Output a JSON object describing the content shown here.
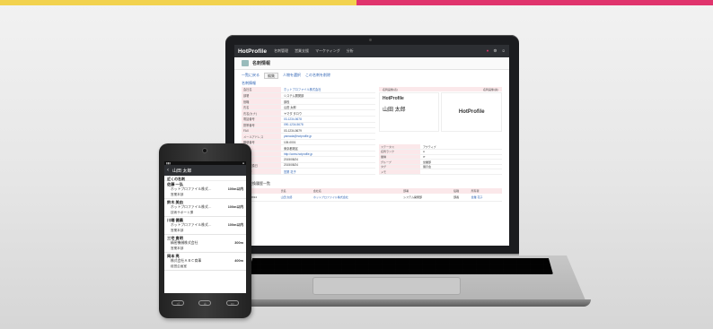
{
  "colors": {
    "strip_left": "#f2d24e",
    "strip_right": "#e0346d",
    "accent": "#e0346d",
    "link": "#3064b4"
  },
  "laptop_app": {
    "logo": "HotProfile",
    "nav": [
      "名刺管理",
      "営業支援",
      "マーケティング",
      "分析"
    ],
    "page_title": "名刺情報",
    "toolbar": {
      "back": "一覧に戻る",
      "edit": "編集",
      "link1": "人物を選択",
      "link2": "この名刺を削除"
    },
    "section_label": "名刺情報",
    "details": [
      {
        "k": "会社名",
        "v": "ホットプロファイル株式会社",
        "link": true
      },
      {
        "k": "部署",
        "v": "システム開発部",
        "link": false
      },
      {
        "k": "役職",
        "v": "部長",
        "link": false
      },
      {
        "k": "氏名",
        "v": "山田 太郎",
        "link": false
      },
      {
        "k": "氏名(カナ)",
        "v": "ヤマダ タロウ",
        "link": false
      },
      {
        "k": "電話番号",
        "v": "03-1234-5678",
        "link": true
      },
      {
        "k": "携帯番号",
        "v": "090-1234-5678",
        "link": true
      },
      {
        "k": "FAX",
        "v": "03-1234-5679",
        "link": false
      },
      {
        "k": "メールアドレス",
        "v": "yamada@hotprofile.jp",
        "link": true
      },
      {
        "k": "郵便番号",
        "v": "105-0001",
        "link": false
      },
      {
        "k": "住所",
        "v": "東京都港区",
        "link": false
      },
      {
        "k": "URL",
        "v": "http://www.hotprofile.jp",
        "link": true
      },
      {
        "k": "受付日",
        "v": "2015/08/24",
        "link": false
      },
      {
        "k": "名刺交換日",
        "v": "2015/08/24",
        "link": false
      },
      {
        "k": "所有者",
        "v": "営業 花子",
        "link": true
      }
    ],
    "card_head": {
      "front": "名刺画像(表)",
      "back": "名刺画像(裏)"
    },
    "card_front": {
      "logo": "HotProfile",
      "name": "山田 太郎"
    },
    "card_back": {
      "logo": "HotProfile"
    },
    "right_table": [
      {
        "k": "ステータス",
        "v": "アクティブ"
      },
      {
        "k": "名刺ランク",
        "v": "A"
      },
      {
        "k": "業種",
        "v": "IT"
      },
      {
        "k": "グループ",
        "v": "営業部"
      },
      {
        "k": "タグ",
        "v": "展示会"
      },
      {
        "k": "メモ",
        "v": ""
      }
    ],
    "list_title": "名刺交換履歴一覧",
    "list_headers": [
      "交換日",
      "氏名",
      "会社名",
      "部署",
      "役職",
      "所有者"
    ],
    "list_rows": [
      [
        "2015/08/24",
        "山田 太郎",
        "ホットプロファイル株式会社",
        "システム開発部",
        "部長",
        "営業 花子"
      ]
    ]
  },
  "phone_app": {
    "header_title": "山田 太郎",
    "section": "近くの名刺",
    "items": [
      {
        "name": "佐藤 一弘",
        "company": "ホットプロファイル株式…",
        "dist": "100m以内",
        "dept": "営業本部"
      },
      {
        "name": "鈴木 美由",
        "company": "ホットプロファイル株式…",
        "dist": "100m以内",
        "dept": "技術サポート課"
      },
      {
        "name": "川端 健義",
        "company": "ホットプロファイル株式…",
        "dist": "100m以内",
        "dept": "営業本部"
      },
      {
        "name": "三宅 貴明",
        "company": "精密機械株式会社",
        "dist": "300m",
        "dept": "営業本部"
      },
      {
        "name": "岡本 亮",
        "company": "株式会社ＡＢＣ商事",
        "dist": "400m",
        "dept": "経営企画室"
      }
    ]
  }
}
